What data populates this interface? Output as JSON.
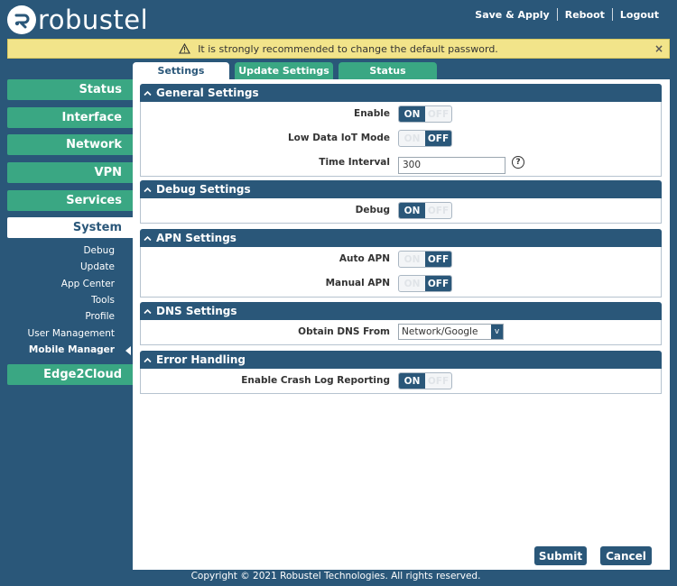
{
  "header": {
    "brand": "robustel",
    "links": {
      "save_apply": "Save & Apply",
      "reboot": "Reboot",
      "logout": "Logout"
    }
  },
  "banner": {
    "message": "It is strongly recommended to change the default password.",
    "close": "×",
    "icon": "warning-triangle-icon"
  },
  "sidebar": {
    "items": [
      {
        "label": "Status"
      },
      {
        "label": "Interface"
      },
      {
        "label": "Network"
      },
      {
        "label": "VPN"
      },
      {
        "label": "Services"
      },
      {
        "label": "System"
      },
      {
        "label": "Edge2Cloud"
      }
    ],
    "system_sub": [
      {
        "label": "Debug"
      },
      {
        "label": "Update"
      },
      {
        "label": "App Center"
      },
      {
        "label": "Tools"
      },
      {
        "label": "Profile"
      },
      {
        "label": "User Management"
      },
      {
        "label": "Mobile Manager"
      }
    ],
    "active_item": "System",
    "current_sub": "Mobile Manager"
  },
  "tabs": [
    {
      "label": "Settings"
    },
    {
      "label": "Update Settings"
    },
    {
      "label": "Status"
    }
  ],
  "sections": {
    "general": {
      "title": "General Settings",
      "enable": {
        "label": "Enable",
        "on": "ON",
        "off": "OFF",
        "state": "ON"
      },
      "low_data": {
        "label": "Low Data IoT Mode",
        "on": "ON",
        "off": "OFF",
        "state": "OFF"
      },
      "time_interval": {
        "label": "Time Interval",
        "value": "300",
        "help": "?"
      }
    },
    "debug": {
      "title": "Debug Settings",
      "debug": {
        "label": "Debug",
        "on": "ON",
        "off": "OFF",
        "state": "ON"
      }
    },
    "apn": {
      "title": "APN Settings",
      "auto_apn": {
        "label": "Auto APN",
        "on": "ON",
        "off": "OFF",
        "state": "OFF"
      },
      "manual_apn": {
        "label": "Manual APN",
        "on": "ON",
        "off": "OFF",
        "state": "OFF"
      }
    },
    "dns": {
      "title": "DNS Settings",
      "obtain_from": {
        "label": "Obtain DNS From",
        "value": "Network/Google",
        "caret": "v"
      }
    },
    "error": {
      "title": "Error Handling",
      "crash_log": {
        "label": "Enable Crash Log Reporting",
        "on": "ON",
        "off": "OFF",
        "state": "ON"
      }
    }
  },
  "buttons": {
    "submit": "Submit",
    "cancel": "Cancel"
  },
  "footer": {
    "copyright": "Copyright © 2021 Robustel Technologies. All rights reserved."
  },
  "colors": {
    "primary": "#2a5779",
    "accent": "#3aa783",
    "banner": "#f2e48a"
  }
}
